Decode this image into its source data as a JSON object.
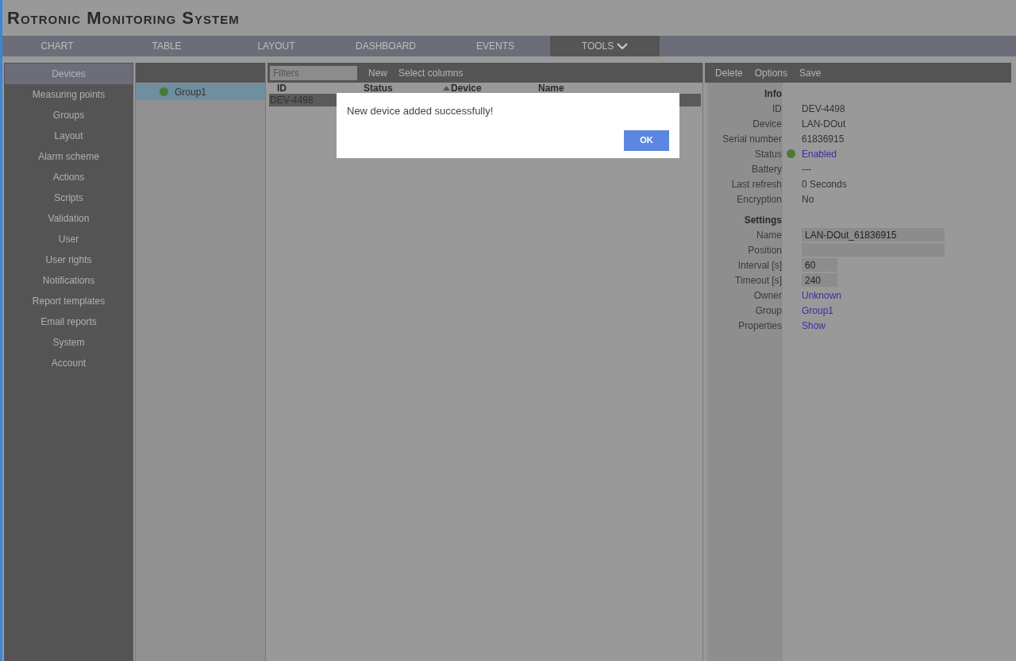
{
  "app_title": "Rotronic Monitoring System",
  "nav_tabs": [
    {
      "label": "CHART",
      "selected": false,
      "dropdown": false
    },
    {
      "label": "TABLE",
      "selected": false,
      "dropdown": false
    },
    {
      "label": "LAYOUT",
      "selected": false,
      "dropdown": false
    },
    {
      "label": "DASHBOARD",
      "selected": false,
      "dropdown": false
    },
    {
      "label": "EVENTS",
      "selected": false,
      "dropdown": false
    },
    {
      "label": "TOOLS",
      "selected": true,
      "dropdown": true
    }
  ],
  "sidebar": {
    "items": [
      {
        "label": "Devices",
        "selected": true
      },
      {
        "label": "Measuring points",
        "selected": false
      },
      {
        "label": "Groups",
        "selected": false
      },
      {
        "label": "Layout",
        "selected": false
      },
      {
        "label": "Alarm scheme",
        "selected": false
      },
      {
        "label": "Actions",
        "selected": false
      },
      {
        "label": "Scripts",
        "selected": false
      },
      {
        "label": "Validation",
        "selected": false
      },
      {
        "label": "User",
        "selected": false
      },
      {
        "label": "User rights",
        "selected": false
      },
      {
        "label": "Notifications",
        "selected": false
      },
      {
        "label": "Report templates",
        "selected": false
      },
      {
        "label": "Email reports",
        "selected": false
      },
      {
        "label": "System",
        "selected": false
      },
      {
        "label": "Account",
        "selected": false
      }
    ]
  },
  "groups": [
    {
      "label": "Group1",
      "color": "#4a7a34",
      "selected": true
    }
  ],
  "table": {
    "toolbar": {
      "filter_placeholder": "Filters",
      "actions": [
        "New",
        "Select columns"
      ]
    },
    "columns": [
      {
        "label": "ID",
        "sorted": false
      },
      {
        "label": "Status",
        "sorted": false
      },
      {
        "label": "Device",
        "sorted": true
      },
      {
        "label": "Name",
        "sorted": false
      }
    ],
    "rows": [
      {
        "cells": [
          "DEV-4498"
        ],
        "selected": true
      }
    ]
  },
  "details": {
    "toolbar": [
      "Delete",
      "Options",
      "Save"
    ],
    "sections": [
      {
        "title": "Info",
        "rows": [
          {
            "kind": "text",
            "label": "ID",
            "value": "DEV-4498"
          },
          {
            "kind": "text",
            "label": "Device",
            "value": "LAN-DOut"
          },
          {
            "kind": "text",
            "label": "Serial number",
            "value": "61836915"
          },
          {
            "kind": "status",
            "label": "Status",
            "value": "Enabled",
            "color": "#4a7a34"
          },
          {
            "kind": "text",
            "label": "Battery",
            "value": "---"
          },
          {
            "kind": "text",
            "label": "Last refresh",
            "value": "0 Seconds"
          },
          {
            "kind": "text",
            "label": "Encryption",
            "value": "No"
          }
        ]
      },
      {
        "title": "Settings",
        "rows": [
          {
            "kind": "input",
            "label": "Name",
            "value": "LAN-DOut_61836915",
            "wide": true
          },
          {
            "kind": "input",
            "label": "Position",
            "value": "",
            "wide": true
          },
          {
            "kind": "input",
            "label": "Interval [s]",
            "value": "60",
            "wide": false
          },
          {
            "kind": "input",
            "label": "Timeout [s]",
            "value": "240",
            "wide": false
          },
          {
            "kind": "link",
            "label": "Owner",
            "value": "Unknown"
          },
          {
            "kind": "link",
            "label": "Group",
            "value": "Group1"
          },
          {
            "kind": "link",
            "label": "Properties",
            "value": "Show"
          }
        ]
      }
    ]
  },
  "dialog": {
    "message": "New device added successfully!",
    "button": "OK"
  }
}
